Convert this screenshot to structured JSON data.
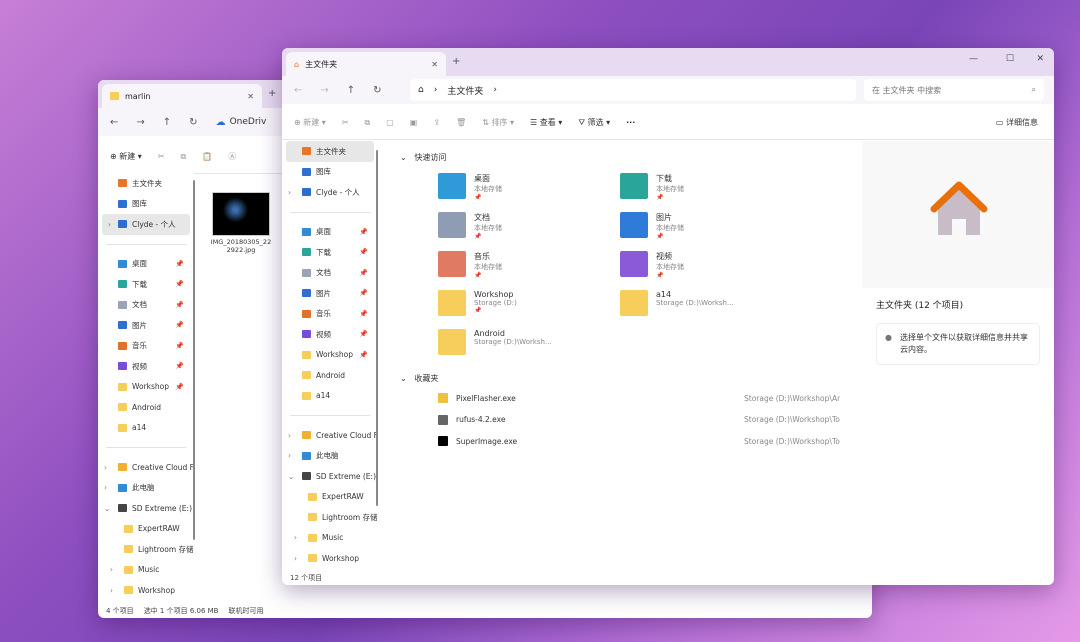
{
  "back": {
    "tab_title": "marlin",
    "crumb": "OneDriv",
    "new_label": "新建",
    "file_name": "IMG_20180305_222922.jpg",
    "sidebar": [
      {
        "label": "主文件夹",
        "icon": "home"
      },
      {
        "label": "图库",
        "icon": "gallery"
      },
      {
        "label": "Clyde - 个人",
        "icon": "cloud",
        "chev": ">",
        "sel": true
      },
      {
        "sep": true
      },
      {
        "label": "桌面",
        "icon": "desktop",
        "pin": true
      },
      {
        "label": "下载",
        "icon": "download",
        "pin": true
      },
      {
        "label": "文档",
        "icon": "doc",
        "pin": true
      },
      {
        "label": "图片",
        "icon": "picture",
        "pin": true
      },
      {
        "label": "音乐",
        "icon": "music",
        "pin": true
      },
      {
        "label": "视频",
        "icon": "video",
        "pin": true
      },
      {
        "label": "Workshop",
        "icon": "folder",
        "pin": true
      },
      {
        "label": "Android",
        "icon": "folder"
      },
      {
        "label": "a14",
        "icon": "folder"
      },
      {
        "sep": true
      },
      {
        "label": "Creative Cloud F",
        "icon": "cc",
        "chev": ">"
      },
      {
        "label": "此电脑",
        "icon": "pc",
        "chev": ">"
      },
      {
        "label": "SD Extreme (E:)",
        "icon": "drive",
        "chev": "v"
      },
      {
        "label": "ExpertRAW",
        "icon": "folder",
        "indent": true
      },
      {
        "label": "Lightroom 存储",
        "icon": "folder",
        "indent": true
      },
      {
        "label": "Music",
        "icon": "folder",
        "chev": ">",
        "indent": true
      },
      {
        "label": "Workshop",
        "icon": "folder",
        "chev": ">",
        "indent": true
      }
    ],
    "status": [
      "4 个项目",
      "选中 1 个项目 6.06 MB",
      "联机时可用"
    ]
  },
  "front": {
    "tab_title": "主文件夹",
    "crumb": "主文件夹",
    "search_placeholder": "在 主文件夹 中搜索",
    "toolbar": {
      "new": "新建",
      "sort": "排序",
      "view": "查看",
      "filter": "筛选",
      "more": "···",
      "details": "详细信息"
    },
    "sidebar": [
      {
        "label": "主文件夹",
        "icon": "home",
        "sel": true
      },
      {
        "label": "图库",
        "icon": "gallery"
      },
      {
        "label": "Clyde - 个人",
        "icon": "cloud",
        "chev": ">"
      },
      {
        "sep": true
      },
      {
        "label": "桌面",
        "icon": "desktop",
        "pin": true
      },
      {
        "label": "下载",
        "icon": "download",
        "pin": true
      },
      {
        "label": "文档",
        "icon": "doc",
        "pin": true
      },
      {
        "label": "图片",
        "icon": "picture",
        "pin": true
      },
      {
        "label": "音乐",
        "icon": "music",
        "pin": true
      },
      {
        "label": "视频",
        "icon": "video",
        "pin": true
      },
      {
        "label": "Workshop",
        "icon": "folder",
        "pin": true
      },
      {
        "label": "Android",
        "icon": "folder"
      },
      {
        "label": "a14",
        "icon": "folder"
      },
      {
        "sep": true
      },
      {
        "label": "Creative Cloud F",
        "icon": "cc",
        "chev": ">"
      },
      {
        "label": "此电脑",
        "icon": "pc",
        "chev": ">"
      },
      {
        "label": "SD Extreme (E:)",
        "icon": "drive",
        "chev": "v"
      },
      {
        "label": "ExpertRAW",
        "icon": "folder",
        "indent": true
      },
      {
        "label": "Lightroom 存储",
        "icon": "folder",
        "indent": true
      },
      {
        "label": "Music",
        "icon": "folder",
        "chev": ">",
        "indent": true
      },
      {
        "label": "Workshop",
        "icon": "folder",
        "chev": ">",
        "indent": true
      }
    ],
    "quick_access_title": "快速访问",
    "quick_access": [
      {
        "name": "桌面",
        "sub": "本地存储",
        "pin": true,
        "color": "#2f9ad8"
      },
      {
        "name": "下载",
        "sub": "本地存储",
        "pin": true,
        "color": "#2aa59a"
      },
      {
        "name": "文档",
        "sub": "本地存储",
        "pin": true,
        "color": "#8e9db4"
      },
      {
        "name": "图片",
        "sub": "本地存储",
        "pin": true,
        "color": "#2f7bd8"
      },
      {
        "name": "音乐",
        "sub": "本地存储",
        "pin": true,
        "color": "#e07a62"
      },
      {
        "name": "视频",
        "sub": "本地存储",
        "pin": true,
        "color": "#8a5ad8"
      },
      {
        "name": "Workshop",
        "sub": "Storage (D:)",
        "pin": true,
        "color": "#f7cd5b"
      },
      {
        "name": "a14",
        "sub": "Storage (D:)\\Worksh...",
        "color": "#f7cd5b"
      },
      {
        "name": "Android",
        "sub": "Storage (D:)\\Worksh...",
        "color": "#f7cd5b"
      }
    ],
    "favorites_title": "收藏夹",
    "favorites": [
      {
        "name": "PixelFlasher.exe",
        "path": "Storage (D:)\\Workshop\\An..."
      },
      {
        "name": "rufus-4.2.exe",
        "path": "Storage (D:)\\Workshop\\To..."
      },
      {
        "name": "SuperImage.exe",
        "path": "Storage (D:)\\Workshop\\To..."
      }
    ],
    "details": {
      "title": "主文件夹 (12 个项目)",
      "note": "选择单个文件以获取详细信息并共享云内容。"
    },
    "status": "12 个项目"
  }
}
